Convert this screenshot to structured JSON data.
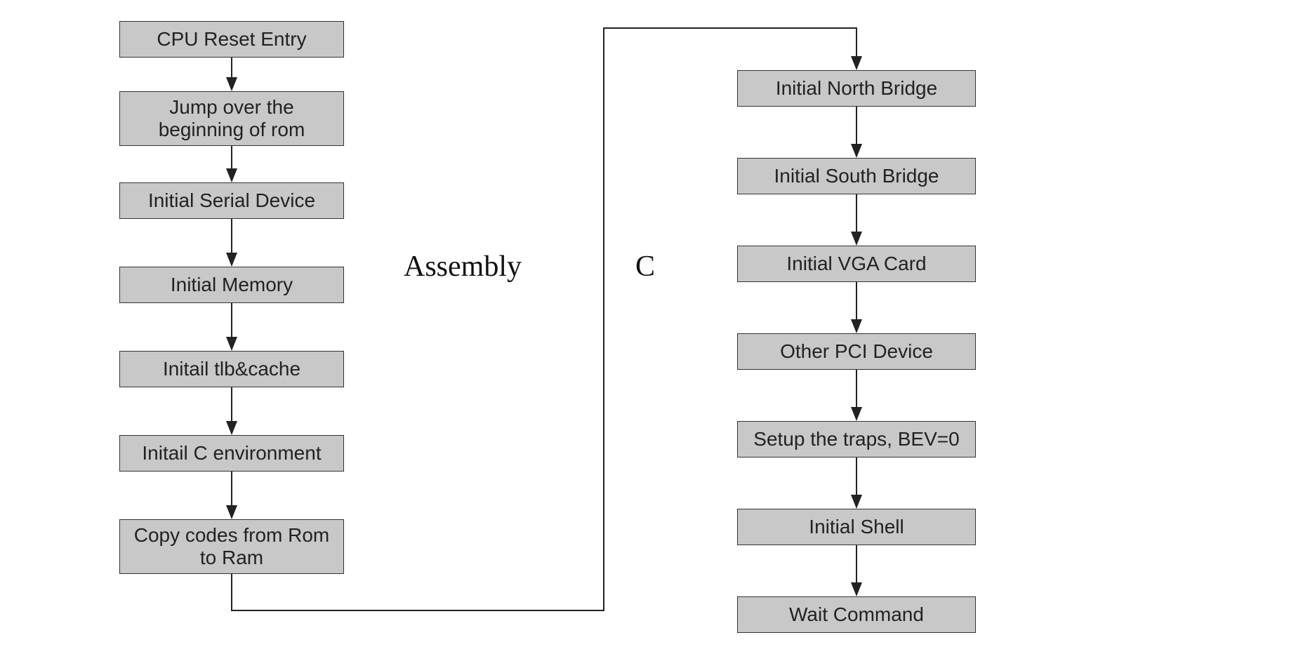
{
  "labels": {
    "assembly": "Assembly",
    "c": "C"
  },
  "left": {
    "b1": "CPU Reset Entry",
    "b2": "Jump over the beginning of rom",
    "b3": "Initial Serial Device",
    "b4": "Initial Memory",
    "b5": "Initail tlb&cache",
    "b6": "Initail C environment",
    "b7": "Copy codes from Rom to Ram"
  },
  "right": {
    "r1": "Initial North Bridge",
    "r2": "Initial South Bridge",
    "r3": "Initial VGA Card",
    "r4": "Other PCI Device",
    "r5": "Setup the traps, BEV=0",
    "r6": "Initial Shell",
    "r7": "Wait  Command"
  }
}
